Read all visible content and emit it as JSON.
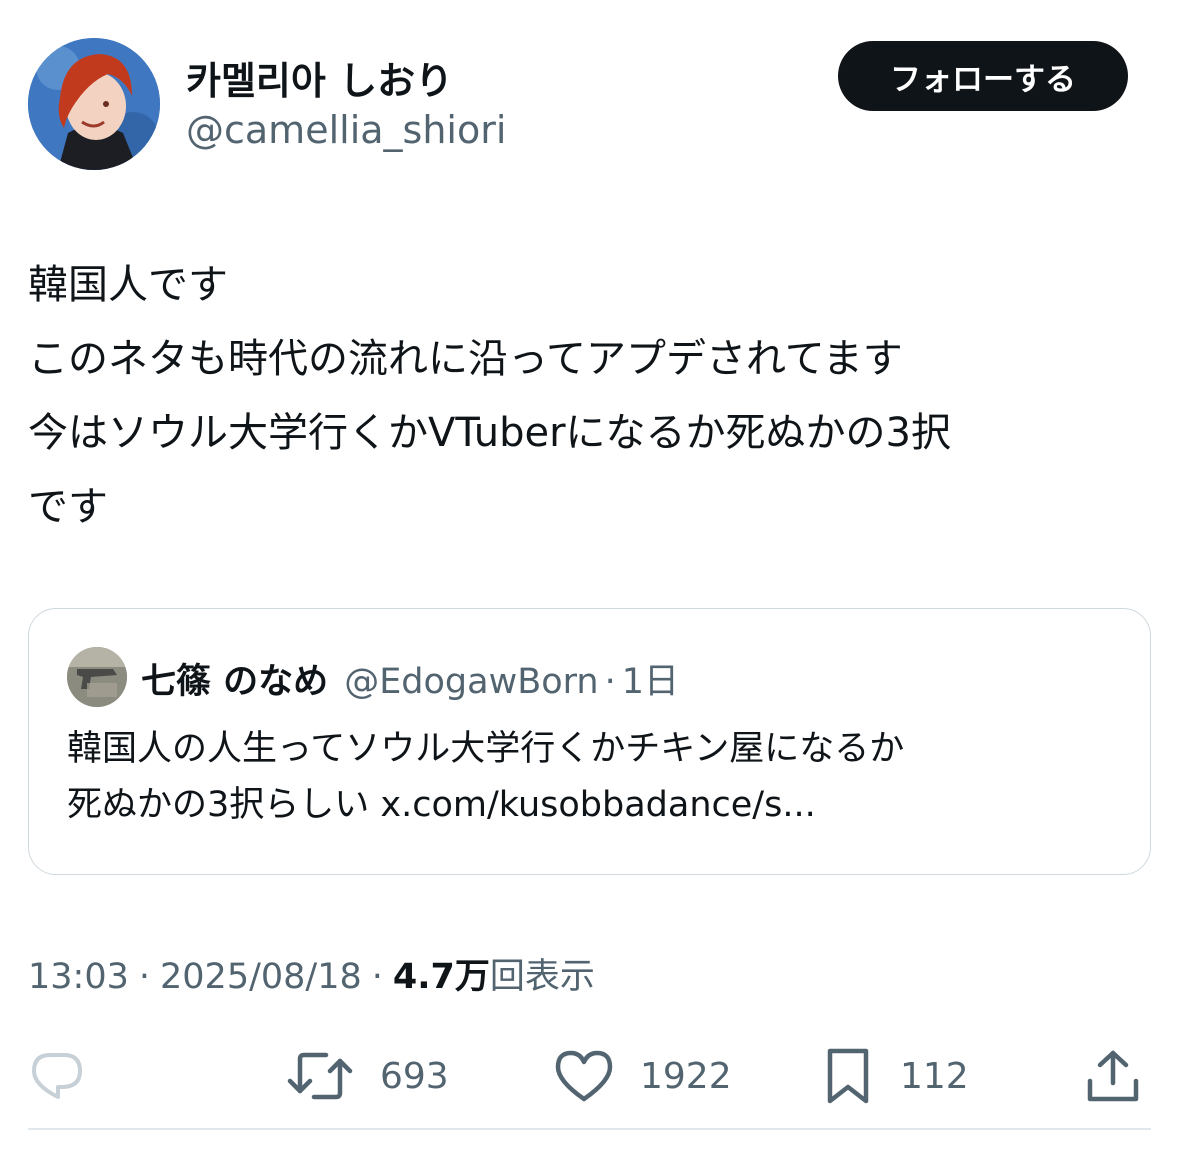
{
  "author": {
    "display_name": "카멜리아 しおり",
    "handle": "@camellia_shiori",
    "avatar_icon": "avatar-illustration-red-hair"
  },
  "follow_button": {
    "label": "フォローする"
  },
  "tweet": {
    "lines": [
      "韓国人です",
      "このネタも時代の流れに沿ってアプデされてます",
      "今はソウル大学行くかVTuberになるか死ぬかの3択",
      "です"
    ]
  },
  "quote": {
    "avatar_icon": "avatar-photo-gun",
    "name": "七篠 のなめ",
    "handle": "@EdogawBorn",
    "dot": "·",
    "time": "1日",
    "lines": [
      "韓国人の人生ってソウル大学行くかチキン屋になるか",
      "死ぬかの3択らしい x.com/kusobbadance/s..."
    ]
  },
  "meta": {
    "time": "13:03",
    "sep1": "·",
    "date": "2025/08/18",
    "sep2": "·",
    "views": "4.7万",
    "views_label": "回表示"
  },
  "actions": {
    "reply": {
      "icon": "reply-icon",
      "count": ""
    },
    "retweet": {
      "icon": "retweet-icon",
      "count": "693"
    },
    "like": {
      "icon": "heart-icon",
      "count": "1922"
    },
    "bookmark": {
      "icon": "bookmark-icon",
      "count": "112"
    },
    "share": {
      "icon": "share-icon"
    }
  },
  "colors": {
    "text": "#0f1419",
    "secondary": "#536471",
    "border": "#cfd9de",
    "button_bg": "#0f1419",
    "button_text": "#ffffff"
  }
}
